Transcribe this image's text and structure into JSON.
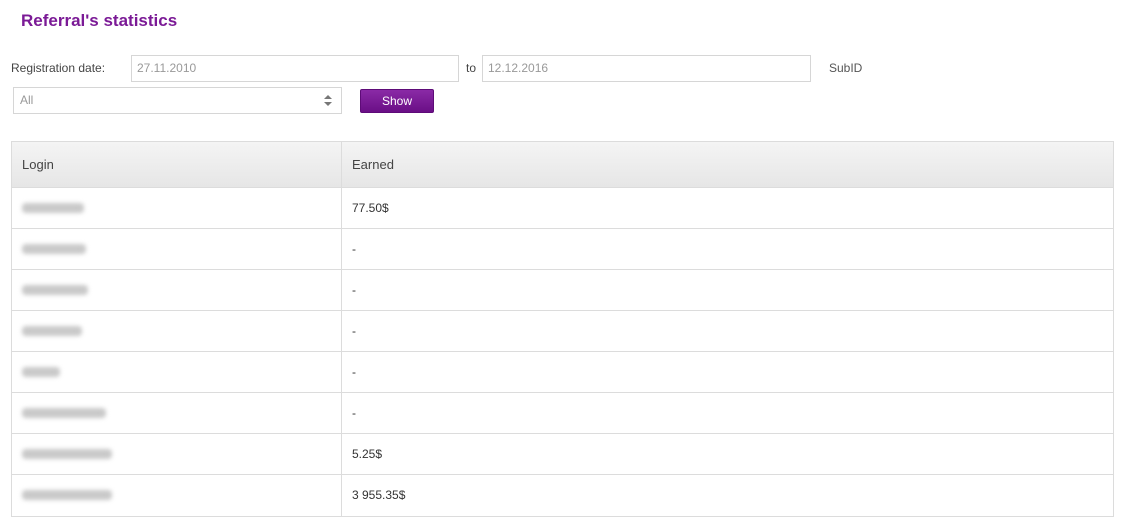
{
  "header": {
    "title": "Referral's statistics"
  },
  "filters": {
    "registration_label": "Registration date:",
    "date_from": "27.11.2010",
    "to_label": "to",
    "date_to": "12.12.2016",
    "subid_label": "SubID",
    "subid_select": "All",
    "show_button": "Show"
  },
  "table": {
    "headers": [
      "Login",
      "Earned"
    ],
    "rows": [
      {
        "login": "",
        "earned": "77.50$"
      },
      {
        "login": "",
        "earned": "-"
      },
      {
        "login": "",
        "earned": "-"
      },
      {
        "login": "",
        "earned": "-"
      },
      {
        "login": "",
        "earned": "-"
      },
      {
        "login": "",
        "earned": "-"
      },
      {
        "login": "",
        "earned": "5.25$"
      },
      {
        "login": "",
        "earned": "3 955.35$"
      }
    ]
  },
  "colors": {
    "accent": "#7b1a96",
    "button": "#7a1c98"
  }
}
